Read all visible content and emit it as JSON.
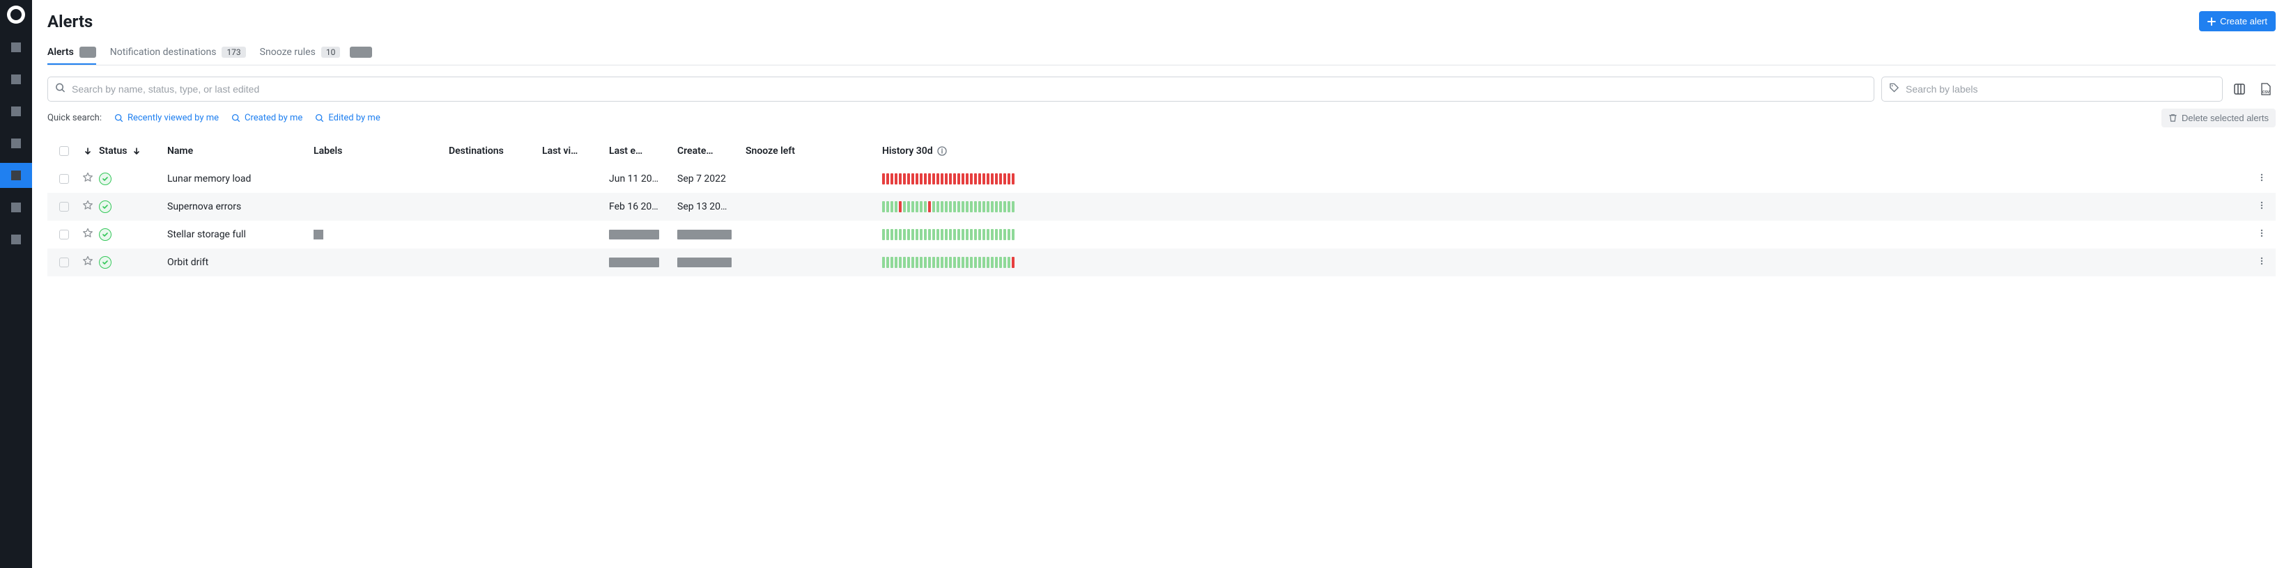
{
  "page_title": "Alerts",
  "create_button_label": "Create alert",
  "tabs": {
    "alerts": {
      "label": "Alerts",
      "count_redacted": true
    },
    "destinations": {
      "label": "Notification destinations",
      "count": "173"
    },
    "snooze": {
      "label": "Snooze rules",
      "count": "10",
      "beta": true
    }
  },
  "search": {
    "placeholder": "Search by name, status, type, or last edited"
  },
  "label_search": {
    "placeholder": "Search by labels"
  },
  "quick_search": {
    "label": "Quick search:",
    "recent": "Recently viewed by me",
    "created": "Created by me",
    "edited": "Edited by me"
  },
  "delete_button_label": "Delete selected alerts",
  "columns": {
    "status": "Status",
    "name": "Name",
    "labels": "Labels",
    "destinations": "Destinations",
    "last_viewed": "Last vi…",
    "last_edited": "Last e…",
    "created": "Create…",
    "snooze": "Snooze left",
    "history": "History 30d"
  },
  "rows": [
    {
      "name": "Lunar memory load",
      "last_edited": "Jun 11 20…",
      "created": "Sep 7 2022",
      "history_pattern": "red_all",
      "has_label_chip": false,
      "dates_redacted": false
    },
    {
      "name": "Supernova errors",
      "last_edited": "Feb 16 20…",
      "created": "Sep 13 20…",
      "history_pattern": "mixed_a",
      "has_label_chip": false,
      "dates_redacted": false
    },
    {
      "name": "Stellar storage full",
      "last_edited": "",
      "created": "",
      "history_pattern": "green_all",
      "has_label_chip": true,
      "dates_redacted": true
    },
    {
      "name": "Orbit drift",
      "last_edited": "",
      "created": "",
      "history_pattern": "green_tail_red",
      "has_label_chip": false,
      "dates_redacted": true
    }
  ]
}
